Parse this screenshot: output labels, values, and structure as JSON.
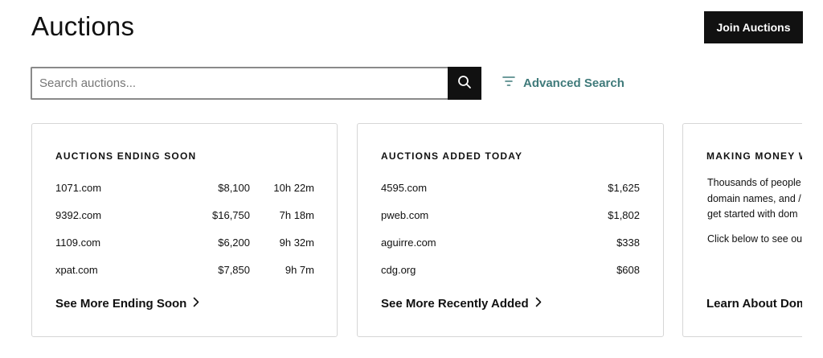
{
  "header": {
    "title": "Auctions",
    "join_label": "Join Auctions"
  },
  "search": {
    "placeholder": "Search auctions...",
    "value": "",
    "advanced_label": "Advanced Search"
  },
  "colors": {
    "accent": "#3f7a7a",
    "button_bg": "#111111",
    "card_border": "#d6d6d6"
  },
  "cards": {
    "ending_soon": {
      "title": "AUCTIONS ENDING SOON",
      "rows": [
        {
          "domain": "1071.com",
          "price": "$8,100",
          "time": "10h 22m"
        },
        {
          "domain": "9392.com",
          "price": "$16,750",
          "time": "7h 18m"
        },
        {
          "domain": "1109.com",
          "price": "$6,200",
          "time": "9h 32m"
        },
        {
          "domain": "xpat.com",
          "price": "$7,850",
          "time": "9h 7m"
        }
      ],
      "link": "See More Ending Soon"
    },
    "added_today": {
      "title": "AUCTIONS ADDED TODAY",
      "rows": [
        {
          "domain": "4595.com",
          "price": "$1,625"
        },
        {
          "domain": "pweb.com",
          "price": "$1,802"
        },
        {
          "domain": "aguirre.com",
          "price": "$338"
        },
        {
          "domain": "cdg.org",
          "price": "$608"
        }
      ],
      "link": "See More Recently Added"
    },
    "making_money": {
      "title": "MAKING MONEY W",
      "lines": [
        "Thousands of people",
        "domain names, and /",
        "get started with dom"
      ],
      "line2": "Click below to see ou",
      "link": "Learn About Doma"
    }
  },
  "icons": {
    "search": "search-icon",
    "filter": "filter-icon",
    "chevron": "chevron-right-icon"
  }
}
